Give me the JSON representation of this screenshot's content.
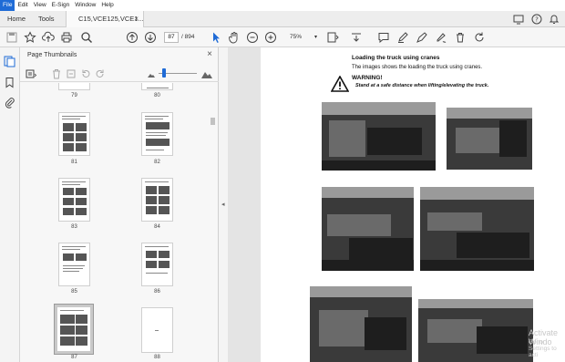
{
  "menu": [
    "File",
    "Edit",
    "View",
    "E-Sign",
    "Window",
    "Help"
  ],
  "tabs": {
    "home": "Home",
    "tools": "Tools",
    "document": "C15,VCE125,VCE1...",
    "close": "×"
  },
  "toolbar": {
    "current_page": "87",
    "total_pages": "/ 894",
    "zoom": "75%"
  },
  "thumbnail_panel": {
    "title": "Page Thumbnails",
    "close": "×",
    "pages": [
      "79",
      "80",
      "81",
      "82",
      "83",
      "84",
      "85",
      "86",
      "87",
      "88"
    ],
    "selected_page": "87"
  },
  "document": {
    "heading": "Loading the truck using cranes",
    "description": "The images shows the loading the truck using cranes.",
    "warning_title": "WARNING!",
    "warning_text": "Stand at a safe distance when lifting/elevating the truck."
  },
  "watermark": {
    "line1": "Activate Windo",
    "line2": "Go to Settings to acti"
  },
  "colors": {
    "accent": "#1f6bd6",
    "page_bg": "#ffffff",
    "canvas_bg": "#e4e4e4"
  }
}
